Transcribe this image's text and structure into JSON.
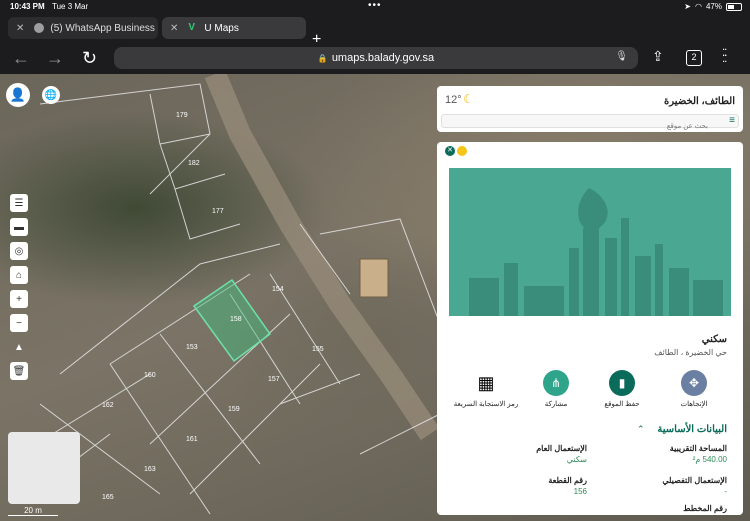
{
  "status_bar": {
    "time": "10:43 PM",
    "date": "Tue 3 Mar",
    "battery": "47%"
  },
  "tabs": [
    {
      "title": "(5) WhatsApp Business",
      "active": false
    },
    {
      "title": "U Maps",
      "active": true
    }
  ],
  "address_bar": {
    "url": "umaps.balady.gov.sa",
    "tab_count": "2"
  },
  "map": {
    "plot_numbers": [
      "179",
      "182",
      "177",
      "154",
      "158",
      "153",
      "155",
      "160",
      "157",
      "162",
      "159",
      "161",
      "163",
      "165"
    ],
    "scale_label": "20 m",
    "highlight_color": "#3fbf7f"
  },
  "panel": {
    "city": "الطائف، الخضيرة",
    "temperature": "12°",
    "search_placeholder": "بحث عن موقع",
    "usage_type": "سكني",
    "location": "حي الخضيرة ، الطائف",
    "actions": [
      {
        "icon": "compass-icon",
        "label": "الإتجاهات",
        "color": "#6b7fa3"
      },
      {
        "icon": "bookmark-icon",
        "label": "حفظ الموقع",
        "color": "#0b6b5b"
      },
      {
        "icon": "share-icon",
        "label": "مشاركة",
        "color": "#2ea58a"
      },
      {
        "icon": "qr-icon",
        "label": "رمز الاستجابة السريعة",
        "color": "#ffffff"
      }
    ],
    "section_title": "البيانات الأساسية",
    "fields": {
      "approx_area_label": "المساحة التقريبية",
      "approx_area_value": "540.00 م²",
      "general_use_label": "الإستعمال العام",
      "general_use_value": "سكني",
      "detailed_use_label": "الإستعمال التفصيلي",
      "detailed_use_value": "-",
      "plot_number_label": "رقم القطعة",
      "plot_number_value": "156",
      "plan_number_label": "رقم المخطط"
    }
  },
  "colors": {
    "brand": "#0b6b5b",
    "accent": "#2e8b57",
    "banner": "#4aa892"
  }
}
